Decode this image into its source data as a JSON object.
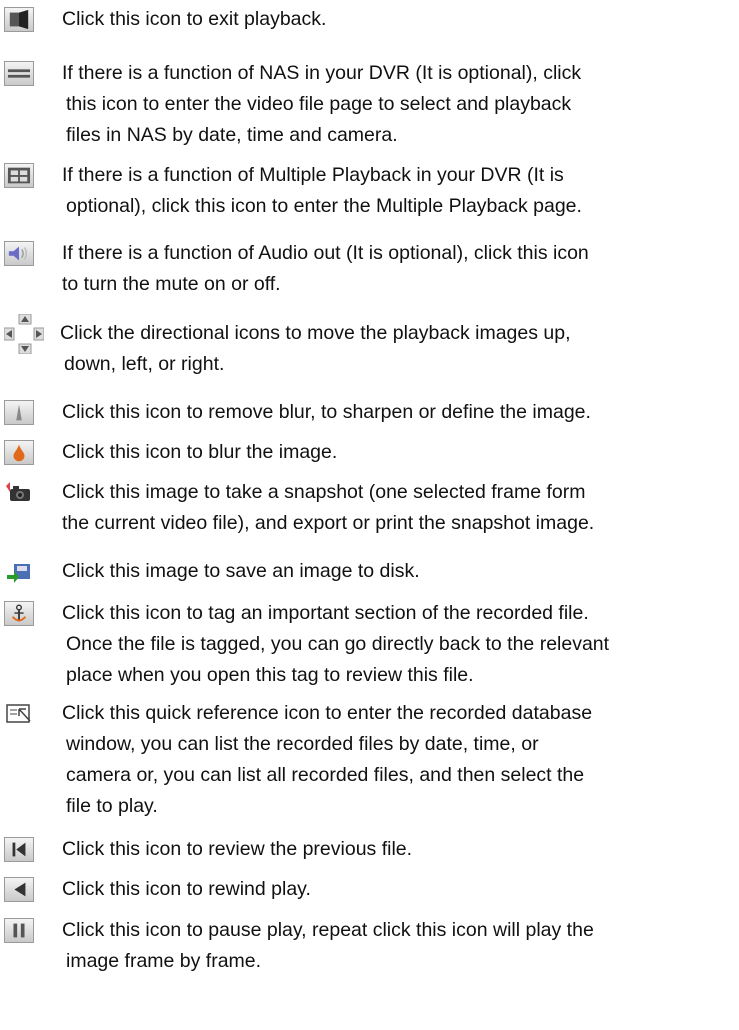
{
  "entries": [
    {
      "icon": "exit-playback-icon",
      "lines": [
        "Click this icon to exit playback."
      ]
    },
    {
      "icon": "nas-icon",
      "lines": [
        "If there is a function of NAS in your DVR (It is optional), click",
        "this icon to enter the video file page to select and playback",
        "files in NAS by date, time and camera."
      ]
    },
    {
      "icon": "multiple-playback-icon",
      "lines": [
        "If there is a function of Multiple Playback in your DVR (It is",
        "optional), click this icon to enter the Multiple Playback page."
      ]
    },
    {
      "icon": "speaker-icon",
      "lines": [
        "If there is a function of Audio out (It is optional), click this icon",
        "to turn the mute on or off."
      ]
    },
    {
      "icon": "directional-arrows-icon",
      "lines": [
        "Click the directional icons to move the playback images up,",
        "down, left, or right."
      ]
    },
    {
      "icon": "sharpen-icon",
      "lines": [
        "Click this icon to remove blur, to sharpen or define the image."
      ]
    },
    {
      "icon": "blur-icon",
      "lines": [
        "Click this icon to blur the image."
      ]
    },
    {
      "icon": "snapshot-camera-icon",
      "lines": [
        "Click this image to take a snapshot (one selected frame form",
        "the current video file), and export or print the snapshot image."
      ]
    },
    {
      "icon": "save-to-disk-icon",
      "lines": [
        "Click this image to save an image to disk."
      ]
    },
    {
      "icon": "tag-anchor-icon",
      "lines": [
        "Click this icon to tag an important section of the recorded file.",
        "Once the file is tagged, you can go directly back to the relevant",
        "place when you open this tag to review this file."
      ]
    },
    {
      "icon": "quick-reference-icon",
      "lines": [
        "Click this quick reference icon to enter the recorded database",
        "window, you can list the recorded files by date, time, or",
        "camera or, you can list all recorded files, and then select the",
        "file to play."
      ]
    },
    {
      "icon": "previous-file-icon",
      "lines": [
        "Click this icon to review the previous file."
      ]
    },
    {
      "icon": "rewind-icon",
      "lines": [
        "Click this icon to rewind play."
      ]
    },
    {
      "icon": "pause-icon",
      "lines": [
        "Click this icon to pause play, repeat click this icon will play the",
        "image frame by frame."
      ]
    }
  ]
}
